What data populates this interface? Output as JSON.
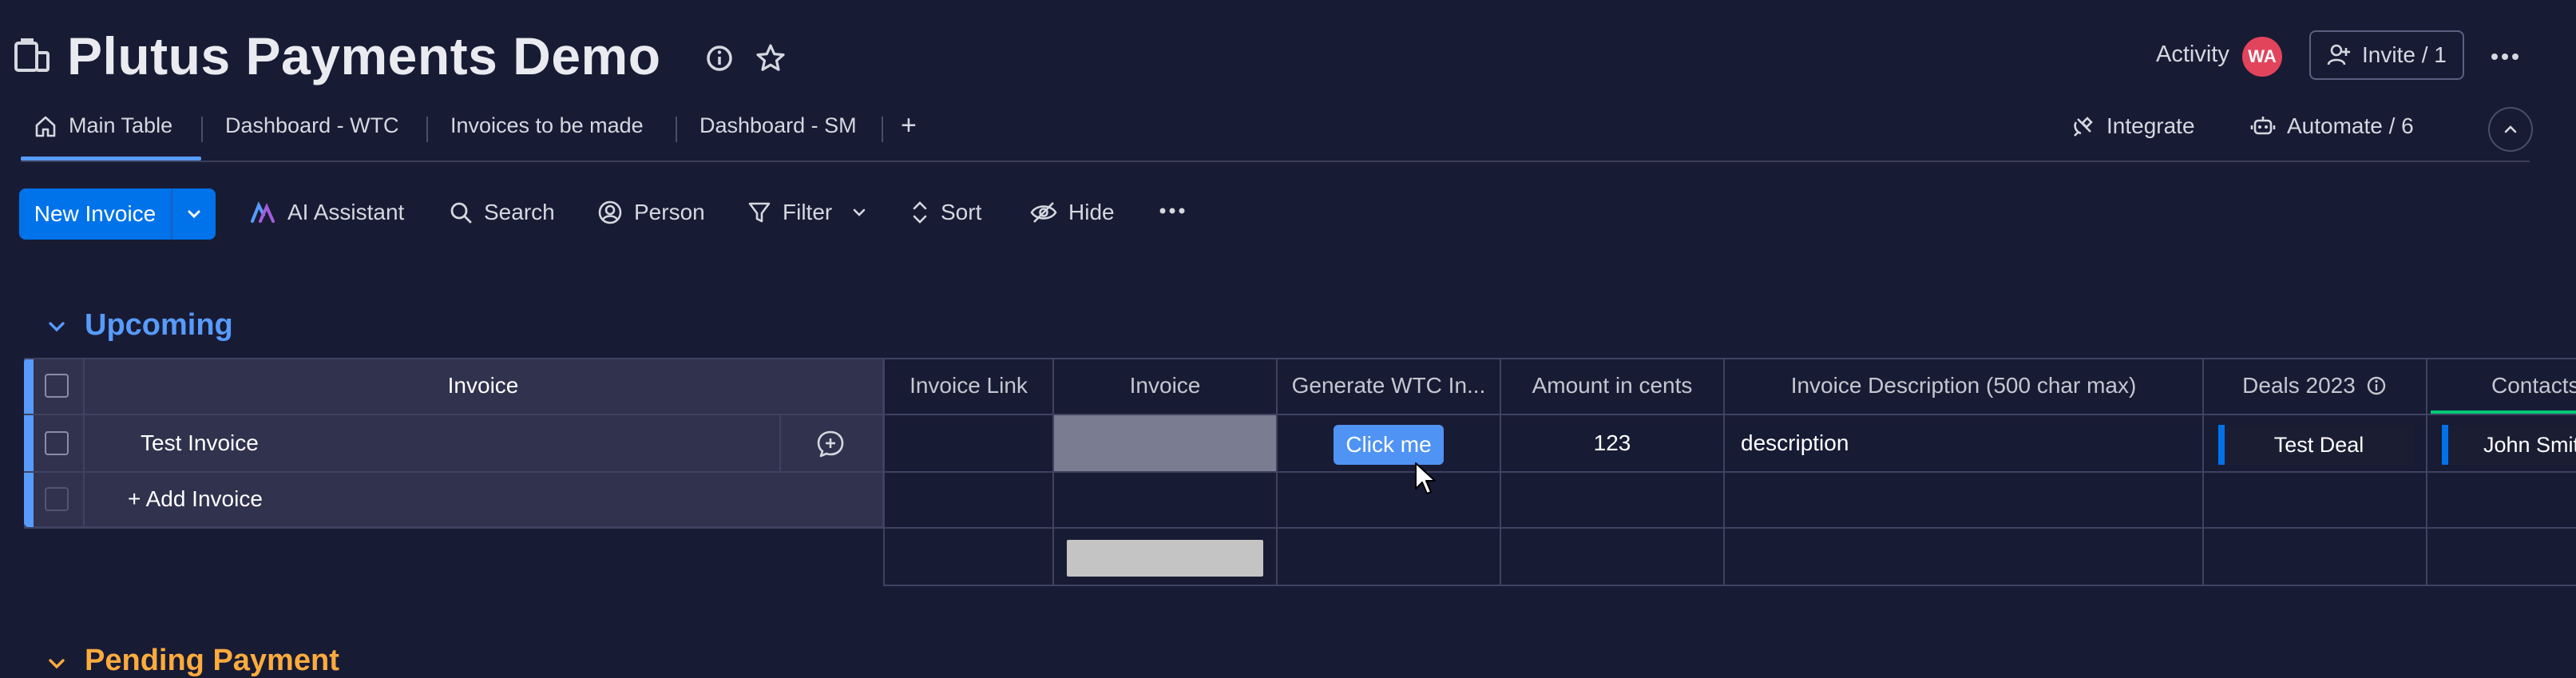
{
  "board": {
    "title": "Plutus Payments Demo"
  },
  "header": {
    "activity_label": "Activity",
    "avatar_initials": "WA",
    "invite_label": "Invite / 1"
  },
  "tabs": [
    {
      "label": "Main Table",
      "active": true
    },
    {
      "label": "Dashboard - WTC"
    },
    {
      "label": "Invoices to be made"
    },
    {
      "label": "Dashboard - SM"
    }
  ],
  "tab_add_label": "+",
  "integrations": {
    "integrate_label": "Integrate",
    "automate_label": "Automate / 6"
  },
  "toolbar": {
    "new_label": "New Invoice",
    "ai_label": "AI Assistant",
    "search_label": "Search",
    "person_label": "Person",
    "filter_label": "Filter",
    "sort_label": "Sort",
    "hide_label": "Hide"
  },
  "groups": [
    {
      "title": "Upcoming",
      "color": "#579bfc",
      "item_header": "Invoice",
      "add_item_label": "+ Add Invoice",
      "columns": [
        {
          "label": "Invoice Link"
        },
        {
          "label": "Invoice"
        },
        {
          "label": "Generate WTC In..."
        },
        {
          "label": "Amount in cents"
        },
        {
          "label": "Invoice Description (500 char max)"
        },
        {
          "label": "Deals 2023"
        },
        {
          "label": "Contacts"
        }
      ],
      "rows": [
        {
          "name": "Test Invoice",
          "button_label": "Click me",
          "amount": "123",
          "description": "description",
          "deal": "Test Deal",
          "contact": "John Smith"
        }
      ]
    },
    {
      "title": "Pending Payment",
      "color": "#fdab3d"
    }
  ],
  "colors": {
    "background": "#181b34",
    "primary": "#0073ea",
    "group_blue": "#579bfc",
    "group_orange": "#fdab3d",
    "avatar": "#e2445c",
    "contacts_accent": "#00c875"
  }
}
